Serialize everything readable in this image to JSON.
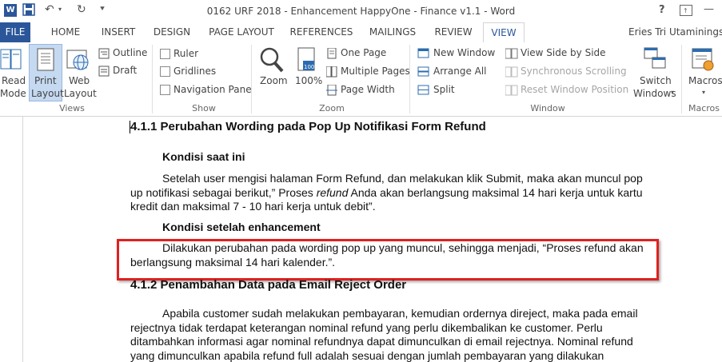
{
  "window": {
    "title": "0162 URF 2018 - Enhancement HappyOne - Finance v1.1 - Word",
    "help": "?",
    "controls": {
      "minimize": "—",
      "maximize": "☐"
    }
  },
  "tabs": {
    "file": "FILE",
    "home": "HOME",
    "insert": "INSERT",
    "design": "DESIGN",
    "page_layout": "PAGE LAYOUT",
    "references": "REFERENCES",
    "mailings": "MAILINGS",
    "review": "REVIEW",
    "view": "VIEW",
    "user": "Eries Tri Utaminingsi"
  },
  "ribbon": {
    "views": {
      "group_label": "Views",
      "read_mode": [
        "Read",
        "Mode"
      ],
      "print_layout": [
        "Print",
        "Layout"
      ],
      "web_layout": [
        "Web",
        "Layout"
      ],
      "outline": "Outline",
      "draft": "Draft"
    },
    "show": {
      "group_label": "Show",
      "ruler": "Ruler",
      "gridlines": "Gridlines",
      "navigation_pane": "Navigation Pane"
    },
    "zoom": {
      "group_label": "Zoom",
      "zoom": "Zoom",
      "hundred": "100%",
      "one_page": "One Page",
      "multiple_pages": "Multiple Pages",
      "page_width": "Page Width"
    },
    "window": {
      "group_label": "Window",
      "new_window": "New Window",
      "arrange_all": "Arrange All",
      "split": "Split",
      "view_side_by_side": "View Side by Side",
      "synchronous_scrolling": "Synchronous Scrolling",
      "reset_window_position": "Reset Window Position",
      "switch_windows": [
        "Switch",
        "Windows"
      ]
    },
    "macros": {
      "group_label": "Macros",
      "macros": "Macros"
    }
  },
  "document": {
    "heading1": "4.1.1 Perubahan Wording pada Pop Up Notifikasi Form Refund",
    "subheading1": "Kondisi saat ini",
    "para1": {
      "line1": "Setelah user mengisi halaman Form Refund, dan melakukan klik Submit, maka akan muncul pop",
      "line2_a": "up notifikasi sebagai berikut,” Proses ",
      "line2_b": "refund",
      "line2_c": " Anda akan berlangsung maksimal 14 hari kerja untuk kartu",
      "line3": "kredit dan maksimal 7 - 10 hari kerja untuk debit”."
    },
    "subheading2": "Kondisi setelah enhancement",
    "para2": {
      "line1": "Dilakukan perubahan pada wording pop up yang muncul, sehingga menjadi, “Proses refund akan",
      "line2": "berlangsung maksimal 14 hari kalender.”."
    },
    "heading2": "4.1.2 Penambahan Data pada Email Reject Order",
    "para3": {
      "line1": "Apabila customer sudah melakukan pembayaran, kemudian ordernya direject, maka pada email",
      "line2": "rejectnya tidak terdapat keterangan nominal refund yang perlu dikembalikan ke customer. Perlu",
      "line3": "ditambahkan informasi agar nominal refundnya dapat dimunculkan di email rejectnya. Nominal refund",
      "line4": "yang dimunculkan apabila refund full adalah sesuai dengan jumlah pembayaran yang dilakukan"
    }
  },
  "colors": {
    "accent": "#2b579a",
    "highlight_box": "#e02020",
    "ribbon_icon": "#2b6cb0"
  }
}
